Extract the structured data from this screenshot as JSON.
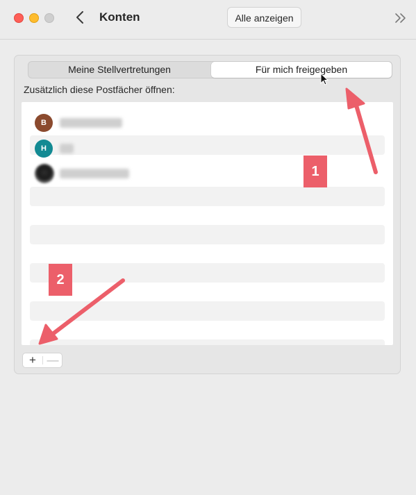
{
  "window": {
    "title": "Konten",
    "show_all_label": "Alle anzeigen",
    "traffic_lights": [
      "#fe5f57",
      "#febc2e",
      "#cfcfcf"
    ]
  },
  "tabs": [
    {
      "label": "Meine Stellvertretungen",
      "selected": false
    },
    {
      "label": "Für mich freigegeben",
      "selected": true
    }
  ],
  "section_label": "Zusätzlich diese Postfächer öffnen:",
  "mailboxes": [
    {
      "avatar_initial": "B",
      "avatar_color": "#8b4a2e"
    },
    {
      "avatar_initial": "H",
      "avatar_color": "#138a93"
    },
    {
      "avatar_initial": "",
      "avatar_color": "photo"
    }
  ],
  "buttons": {
    "add_label": "+",
    "remove_label": "—"
  },
  "annotations": {
    "callout_1": "1",
    "callout_2": "2",
    "color": "#ec5f6a"
  },
  "icons": [
    "back-chevron-icon",
    "double-chevron-right-icon",
    "mouse-pointer-icon"
  ]
}
